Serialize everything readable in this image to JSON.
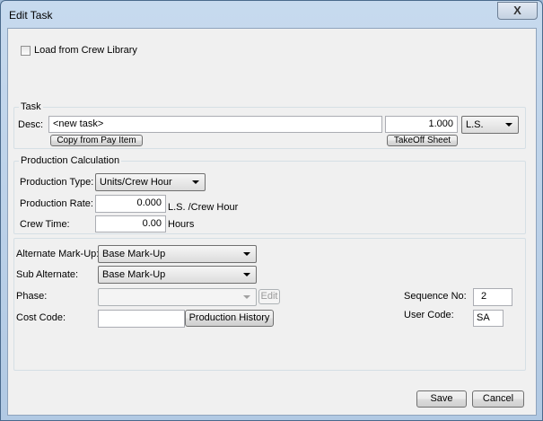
{
  "window": {
    "title": "Edit Task",
    "close_glyph": "X"
  },
  "crew_library": {
    "checkbox_label": "Load from Crew Library",
    "checked": false
  },
  "task": {
    "group_label": "Task",
    "desc_label": "Desc:",
    "desc_value": "<new task>",
    "quantity_value": "1.000",
    "unit_value": "L.S.",
    "copy_button": "Copy from Pay Item",
    "takeoff_button": "TakeOff Sheet"
  },
  "production": {
    "group_label": "Production Calculation",
    "type_label": "Production Type:",
    "type_value": "Units/Crew Hour",
    "rate_label": "Production Rate:",
    "rate_value": "0.000",
    "rate_units": "L.S. /Crew Hour",
    "crew_time_label": "Crew Time:",
    "crew_time_value": "0.00",
    "crew_time_units": "Hours"
  },
  "markup": {
    "alternate_label": "Alternate Mark-Up:",
    "alternate_value": "Base Mark-Up",
    "sub_alternate_label": "Sub Alternate:",
    "sub_alternate_value": "Base Mark-Up",
    "phase_label": "Phase:",
    "phase_value": "",
    "edit_button": "Edit",
    "cost_code_label": "Cost Code:",
    "cost_code_value": "",
    "production_history_button": "Production History",
    "sequence_label": "Sequence No:",
    "sequence_value": "2",
    "user_code_label": "User Code:",
    "user_code_value": "SA"
  },
  "footer": {
    "save_button": "Save",
    "cancel_button": "Cancel"
  }
}
